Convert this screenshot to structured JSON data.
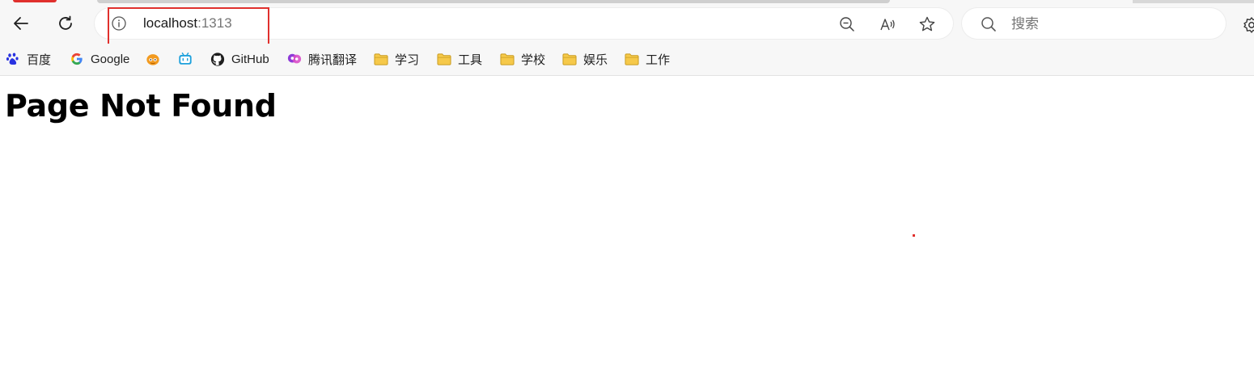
{
  "toolbar": {
    "address": {
      "host": "localhost",
      "port": ":1313"
    },
    "search": {
      "placeholder": "搜索"
    }
  },
  "bookmarks": [
    {
      "label": "百度",
      "icon": "baidu-icon"
    },
    {
      "label": "Google",
      "icon": "google-icon"
    },
    {
      "label": "",
      "icon": "orange-fox-icon"
    },
    {
      "label": "",
      "icon": "bilibili-icon"
    },
    {
      "label": "GitHub",
      "icon": "github-icon"
    },
    {
      "label": "腾讯翻译",
      "icon": "tencent-translate-icon"
    },
    {
      "label": "学习",
      "icon": "folder-icon"
    },
    {
      "label": "工具",
      "icon": "folder-icon"
    },
    {
      "label": "学校",
      "icon": "folder-icon"
    },
    {
      "label": "娱乐",
      "icon": "folder-icon"
    },
    {
      "label": "工作",
      "icon": "folder-icon"
    }
  ],
  "page": {
    "heading": "Page Not Found"
  },
  "colors": {
    "highlight": "#e0302d",
    "folder": "#f6c94a",
    "toolbar_bg": "#f7f7f7"
  }
}
